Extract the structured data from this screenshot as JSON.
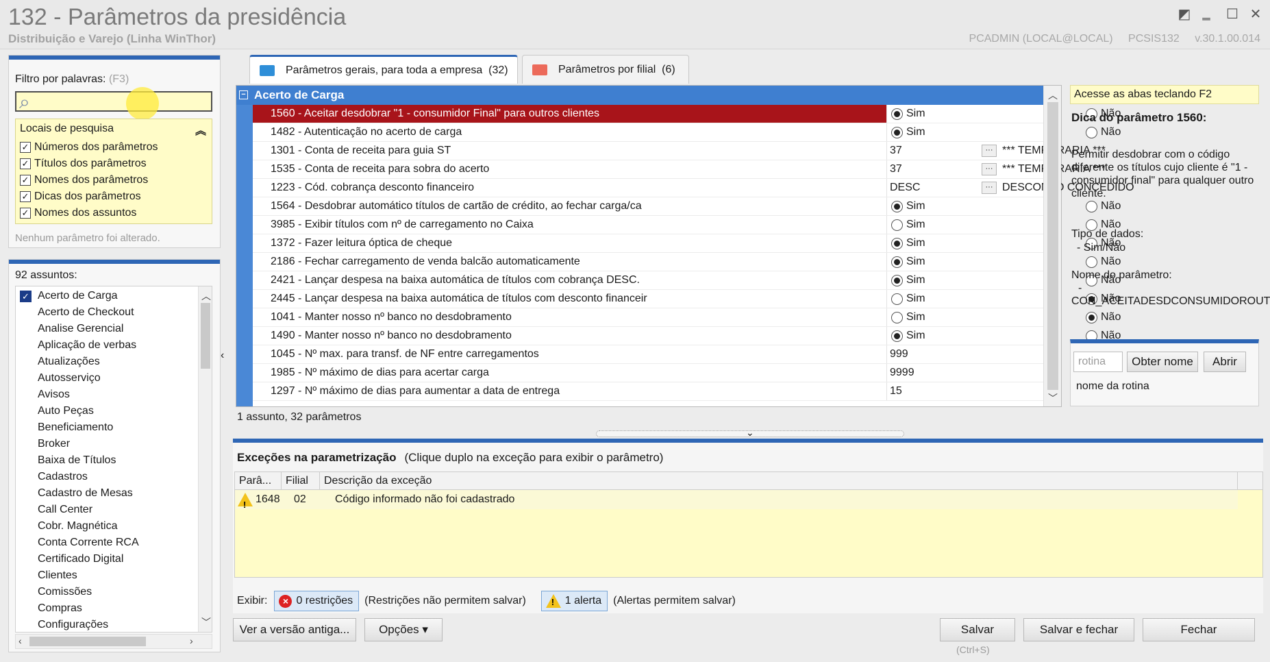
{
  "window": {
    "title": "132 - Parâmetros da presidência",
    "subtitle": "Distribuição e Varejo (Linha WinThor)",
    "user": "PCADMIN (LOCAL@LOCAL)",
    "program": "PCSIS132",
    "version": "v.30.1.00.014"
  },
  "filter": {
    "label": "Filtro por palavras:",
    "hint": "(F3)",
    "value": ""
  },
  "search_locations": {
    "title": "Locais de pesquisa",
    "options": [
      {
        "label": "Números dos parâmetros",
        "checked": true
      },
      {
        "label": "Títulos dos parâmetros",
        "checked": true
      },
      {
        "label": "Nomes dos parâmetros",
        "checked": true
      },
      {
        "label": "Dicas dos parâmetros",
        "checked": true
      },
      {
        "label": "Nomes dos assuntos",
        "checked": true
      }
    ],
    "status": "Nenhum parâmetro foi alterado."
  },
  "subjects": {
    "count_label": "92 assuntos:",
    "items": [
      "Acerto de Carga",
      "Acerto de Checkout",
      "Analise Gerencial",
      "Aplicação de verbas",
      "Atualizações",
      "Autosserviço",
      "Avisos",
      "Auto Peças",
      "Beneficiamento",
      "Broker",
      "Baixa de Títulos",
      "Cadastros",
      "Cadastro de Mesas",
      "Call Center",
      "Cobr. Magnética",
      "Conta Corrente RCA",
      "Certificado Digital",
      "Clientes",
      "Comissões",
      "Compras",
      "Configurações"
    ]
  },
  "tabs": [
    {
      "label": "Parâmetros gerais, para toda a empresa",
      "count": "(32)"
    },
    {
      "label": "Parâmetros por filial",
      "count": "(6)"
    }
  ],
  "grid": {
    "group": "Acerto de Carga",
    "yes": "Sim",
    "no": "Não",
    "rows": [
      {
        "name": "1560 - Aceitar desdobrar \"1 - consumidor Final\" para outros clientes",
        "type": "bool",
        "value": "sim",
        "selected": true
      },
      {
        "name": "1482 - Autenticação no acerto de carga",
        "type": "bool",
        "value": "sim"
      },
      {
        "name": "1301 - Conta de receita para guia ST",
        "type": "lookup",
        "value": "37",
        "desc": "*** TEMPORARIA ***"
      },
      {
        "name": "1535 - Conta de receita para sobra do acerto",
        "type": "lookup",
        "value": "37",
        "desc": "*** TEMPORARIA ***"
      },
      {
        "name": "1223 - Cód. cobrança desconto financeiro",
        "type": "lookup",
        "value": "DESC",
        "desc": "DESCONTO CONCEDIDO"
      },
      {
        "name": "1564 - Desdobrar automático títulos de cartão de crédito, ao fechar carga/ca",
        "type": "bool",
        "value": "sim"
      },
      {
        "name": "3985 - Exibir títulos com nº de carregamento no Caixa",
        "type": "bool",
        "value": "none"
      },
      {
        "name": "1372 - Fazer leitura óptica de cheque",
        "type": "bool",
        "value": "sim"
      },
      {
        "name": "2186 - Fechar carregamento de venda balcão automaticamente",
        "type": "bool",
        "value": "sim"
      },
      {
        "name": "2421 - Lançar despesa na baixa automática de títulos com cobrança DESC.",
        "type": "bool",
        "value": "sim"
      },
      {
        "name": "2445 - Lançar despesa na baixa automática de títulos com desconto financeir",
        "type": "bool",
        "value": "nao"
      },
      {
        "name": "1041 - Manter nosso nº banco no desdobramento",
        "type": "bool",
        "value": "nao"
      },
      {
        "name": "1490 - Manter nosso nº banco no desdobramento",
        "type": "bool",
        "value": "sim"
      },
      {
        "name": "1045 - Nº max. para transf. de NF entre carregamentos",
        "type": "text",
        "value": "999"
      },
      {
        "name": "1985 - Nº máximo de dias para acertar carga",
        "type": "text",
        "value": "9999"
      },
      {
        "name": "1297 - Nº máximo de dias para aumentar a data de entrega",
        "type": "text",
        "value": "15"
      }
    ],
    "footer": "1 assunto, 32 parâmetros"
  },
  "tip": {
    "header": "Acesse as abas teclando F2",
    "title": "Dica do parâmetro 1560:",
    "body": "Permitir desdobrar com o código diferente os títulos cujo cliente é \"1 - consumidor final\" para qualquer outro cliente.",
    "type_label": "Tipo de dados:",
    "type_value": "- Sim/Não",
    "name_label": "Nome do parâmetro:",
    "name_dash": "-",
    "name_value": "CON_ACEITADESDCONSUMIDOROUT"
  },
  "routine": {
    "placeholder": "rotina",
    "get_name": "Obter nome",
    "open": "Abrir",
    "name_label": "nome da rotina"
  },
  "exceptions": {
    "title": "Exceções na parametrização",
    "hint": "(Clique duplo na exceção para exibir o parâmetro)",
    "columns": [
      "Parâ...",
      "Filial",
      "Descrição da exceção"
    ],
    "rows": [
      {
        "param": "1648",
        "filial": "02",
        "desc": "Código informado não foi cadastrado"
      }
    ],
    "show_label": "Exibir:",
    "restrictions": "0 restrições",
    "restrictions_note": "(Restrições não permitem salvar)",
    "alerts": "1 alerta",
    "alerts_note": "(Alertas permitem salvar)"
  },
  "buttons": {
    "old_version": "Ver a versão antiga...",
    "options": "Opções",
    "save": "Salvar",
    "save_shortcut": "(Ctrl+S)",
    "save_close": "Salvar e fechar",
    "close": "Fechar"
  },
  "colors": {
    "accent": "#2e66b5",
    "group_header": "#3f7fd0",
    "selected_row": "#a8141a",
    "tip_yellow": "#fffcc8"
  }
}
